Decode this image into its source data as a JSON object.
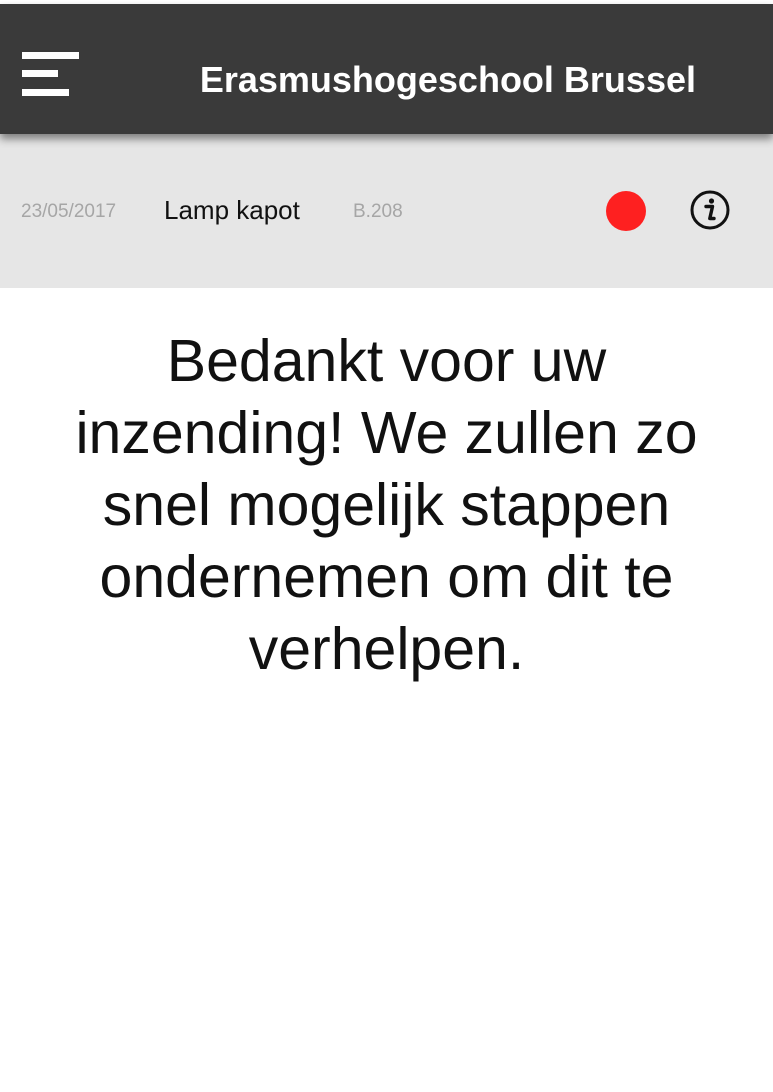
{
  "header": {
    "menu_icon": "hamburger-menu-icon",
    "title": "Erasmushogeschool Brussel",
    "background_color": "#3a3a3a"
  },
  "report": {
    "date": "23/05/2017",
    "title": "Lamp kapot",
    "room": "B.208",
    "status_icon": "status-dot-icon",
    "status_color": "#fe2020",
    "info_icon": "info-icon"
  },
  "confirmation": {
    "message": "Bedankt voor uw inzending! We zullen zo snel mogelijk stappen ondernemen om dit te verhelpen."
  }
}
